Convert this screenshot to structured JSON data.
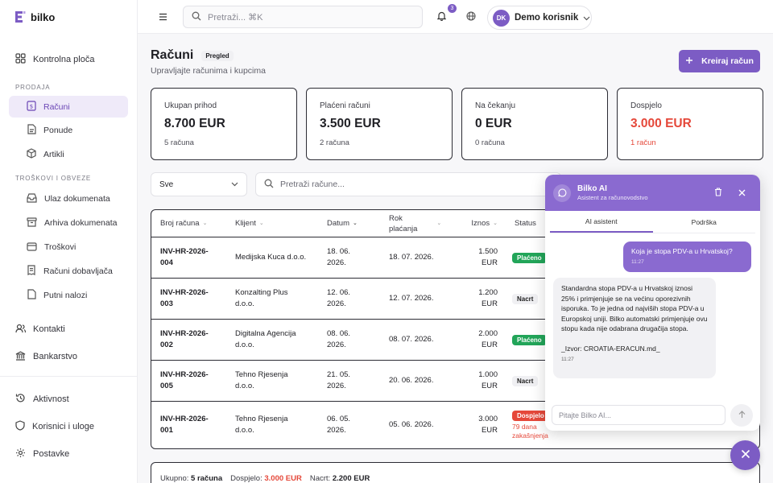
{
  "brand": {
    "name": "bilko",
    "accent": "#7c5cc4"
  },
  "sidebar": {
    "dashboard": "Kontrolna ploča",
    "section_sales": "PRODAJA",
    "sales_items": [
      {
        "label": "Računi",
        "icon": "invoice-icon"
      },
      {
        "label": "Ponude",
        "icon": "document-icon"
      },
      {
        "label": "Artikli",
        "icon": "box-icon"
      }
    ],
    "section_costs": "TROŠKOVI I OBVEZE",
    "cost_items": [
      {
        "label": "Ulaz dokumenata",
        "icon": "inbox-icon"
      },
      {
        "label": "Arhiva dokumenata",
        "icon": "archive-icon"
      },
      {
        "label": "Troškovi",
        "icon": "wallet-icon"
      },
      {
        "label": "Računi dobavljača",
        "icon": "receipt-icon"
      },
      {
        "label": "Putni nalozi",
        "icon": "file-icon"
      }
    ],
    "contacts": "Kontakti",
    "banking": "Bankarstvo",
    "activity": "Aktivnost",
    "users": "Korisnici i uloge",
    "settings": "Postavke"
  },
  "topbar": {
    "search_placeholder": "Pretraži... ⌘K",
    "notification_count": "3",
    "user_initials": "DK",
    "user_name": "Demo korisnik"
  },
  "page": {
    "title": "Računi",
    "badge": "Pregled",
    "subtitle": "Upravljajte računima i kupcima",
    "create_label": "Kreiraj račun"
  },
  "cards": [
    {
      "label": "Ukupan prihod",
      "value": "8.700 EUR",
      "sub": "5 računa",
      "alert": false
    },
    {
      "label": "Plaćeni računi",
      "value": "3.500 EUR",
      "sub": "2 računa",
      "alert": false
    },
    {
      "label": "Na čekanju",
      "value": "0 EUR",
      "sub": "0 računa",
      "alert": false
    },
    {
      "label": "Dospjelo",
      "value": "3.000 EUR",
      "sub": "1 račun",
      "alert": true
    }
  ],
  "filter": {
    "selected": "Sve",
    "search_placeholder": "Pretraži račune..."
  },
  "table": {
    "headers": {
      "number": "Broj računa",
      "client": "Klijent",
      "date": "Datum",
      "due_line1": "Rok",
      "due_line2": "plaćanja",
      "amount": "Iznos",
      "status": "Status"
    },
    "rows": [
      {
        "num1": "INV-HR-2026-",
        "num2": "004",
        "client1": "Medijska Kuca d.o.o.",
        "client2": "",
        "date1": "18. 06.",
        "date2": "2026.",
        "due": "18. 07. 2026.",
        "amt1": "1.500",
        "amt2": "EUR",
        "status": "Plaćeno",
        "type": "paid",
        "note1": "",
        "note2": ""
      },
      {
        "num1": "INV-HR-2026-",
        "num2": "003",
        "client1": "Konzalting Plus",
        "client2": "d.o.o.",
        "date1": "12. 06.",
        "date2": "2026.",
        "due": "12. 07. 2026.",
        "amt1": "1.200",
        "amt2": "EUR",
        "status": "Nacrt",
        "type": "draft",
        "note1": "",
        "note2": ""
      },
      {
        "num1": "INV-HR-2026-",
        "num2": "002",
        "client1": "Digitalna Agencija",
        "client2": "d.o.o.",
        "date1": "08. 06.",
        "date2": "2026.",
        "due": "08. 07. 2026.",
        "amt1": "2.000",
        "amt2": "EUR",
        "status": "Plaćeno",
        "type": "paid",
        "note1": "",
        "note2": ""
      },
      {
        "num1": "INV-HR-2026-",
        "num2": "005",
        "client1": "Tehno Rjesenja",
        "client2": "d.o.o.",
        "date1": "21. 05.",
        "date2": "2026.",
        "due": "20. 06. 2026.",
        "amt1": "1.000",
        "amt2": "EUR",
        "status": "Nacrt",
        "type": "draft",
        "note1": "",
        "note2": ""
      },
      {
        "num1": "INV-HR-2026-",
        "num2": "001",
        "client1": "Tehno Rjesenja",
        "client2": "d.o.o.",
        "date1": "06. 05.",
        "date2": "2026.",
        "due": "05. 06. 2026.",
        "amt1": "3.000",
        "amt2": "EUR",
        "status": "Dospjelo",
        "type": "due",
        "note1": "79 dana",
        "note2": "zakašnjenja"
      }
    ]
  },
  "summary": {
    "total_label": "Ukupno:",
    "total_value": "5 računa",
    "due_label": "Dospjelo:",
    "due_value": "3.000 EUR",
    "draft_label": "Nacrt:",
    "draft_value": "2.200 EUR"
  },
  "chat": {
    "title": "Bilko AI",
    "subtitle": "Asistent za računovodstvo",
    "tab_ai": "AI asistent",
    "tab_support": "Podrška",
    "user_msg": "Koja je stopa PDV-a u Hrvatskoj?",
    "user_time": "11:27",
    "ai_msg": "Standardna stopa PDV-a u Hrvatskoj iznosi 25% i primjenjuje se na većinu oporezivnih isporuka. To je jedna od najviših stopa PDV-a u Europskoj uniji. Bilko automatski primjenjuje ovu stopu kada nije odabrana drugačija stopa.",
    "ai_source": "_Izvor: CROATIA-ERACUN.md_",
    "ai_time": "11:27",
    "input_placeholder": "Pitajte Bilko AI..."
  }
}
